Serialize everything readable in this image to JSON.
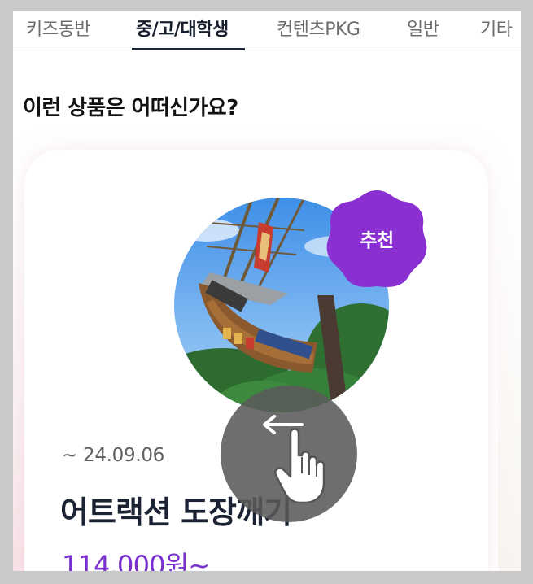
{
  "tabs": [
    {
      "label": "키즈동반",
      "active": false
    },
    {
      "label": "중/고/대학생",
      "active": true
    },
    {
      "label": "컨텐츠PKG",
      "active": false
    },
    {
      "label": "일반",
      "active": false
    },
    {
      "label": "기타",
      "active": false
    }
  ],
  "section": {
    "title": "이런 상품은 어떠신가요?"
  },
  "product": {
    "badge": "추천",
    "date": "~ 24.09.06",
    "name": "어트랙션 도장깨기",
    "price": "114,000원~"
  },
  "overlay": {
    "icons": [
      "swipe-left-arrow-icon",
      "hand-pointer-icon"
    ]
  },
  "colors": {
    "accent_purple": "#7a2fd0",
    "badge_purple": "#8a2fd0",
    "dark_text": "#1b2233",
    "overlay_gray": "#5a5a5a"
  }
}
